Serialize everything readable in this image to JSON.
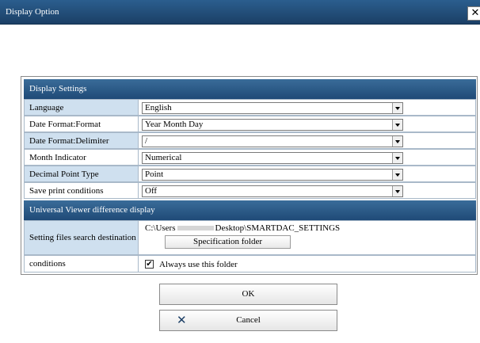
{
  "window": {
    "title": "Display Option",
    "close_glyph": "✕"
  },
  "display_settings": {
    "header": "Display Settings",
    "rows": [
      {
        "label": "Language",
        "value": "English"
      },
      {
        "label": "Date Format:Format",
        "value": "Year Month Day"
      },
      {
        "label": "Date Format:Delimiter",
        "value": "/"
      },
      {
        "label": "Month Indicator",
        "value": "Numerical"
      },
      {
        "label": "Decimal Point Type",
        "value": "Point"
      },
      {
        "label": "Save print conditions",
        "value": "Off"
      }
    ]
  },
  "viewer_section": {
    "header": "Universal Viewer difference display",
    "search_label": "Setting files search destination",
    "path_prefix": "C:\\Users",
    "path_suffix": "Desktop\\SMARTDAC_SETTINGS",
    "spec_button": "Specification folder",
    "conditions_label": "conditions",
    "checkbox_checked": true,
    "checkbox_label": "Always use this folder"
  },
  "buttons": {
    "ok": "OK",
    "cancel": "Cancel",
    "cancel_icon": "✕"
  }
}
